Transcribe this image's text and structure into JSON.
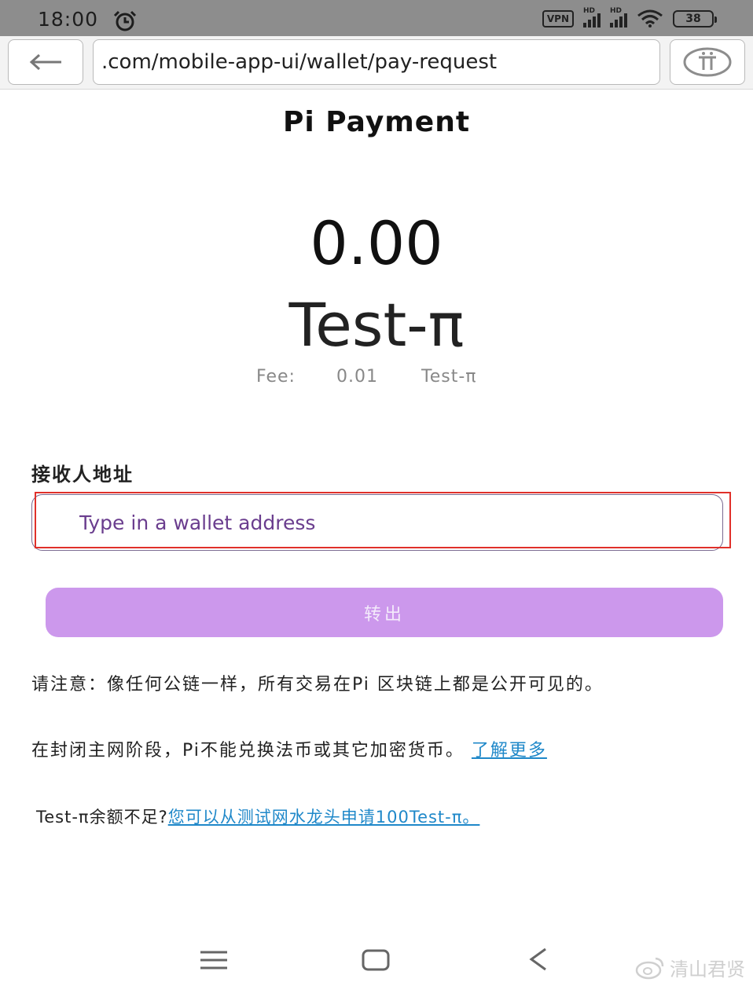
{
  "status_bar": {
    "time": "18:00",
    "vpn_label": "VPN",
    "signal_label_1": "HD",
    "signal_label_2": "HD",
    "battery_level": "38"
  },
  "browser": {
    "url": ".com/mobile-app-ui/wallet/pay-request"
  },
  "page": {
    "title": "Pi Payment",
    "amount": "0.00",
    "currency": "Test-π",
    "fee_label": "Fee:",
    "fee_value": "0.01",
    "fee_currency": "Test-π",
    "recipient_label": "接收人地址",
    "address_placeholder": "Type in a wallet address",
    "transfer_label": "转出",
    "notice_public": "请注意：像任何公链一样，所有交易在Pi 区块链上都是公开可见的。",
    "notice_mainnet": "在封闭主网阶段，Pi不能兑换法币或其它加密货币。",
    "learn_more": "了解更多",
    "insufficient_prefix": "Test-π余额不足?",
    "faucet_link": "您可以从测试网水龙头申请100Test-π。"
  },
  "watermark": "清山君贤",
  "colors": {
    "accent_purple": "#cc98ec",
    "placeholder_purple": "#6a3d8e",
    "link_blue": "#1f88c9",
    "highlight_red": "#e0302a",
    "status_bar_bg": "#8d8d8d"
  },
  "icons": {
    "alarm": "alarm-icon",
    "wifi": "wifi-icon",
    "back": "back-arrow-icon",
    "pi_logo": "pi-logo-icon",
    "nav_menu": "menu-icon",
    "nav_home": "home-icon",
    "nav_back": "back-chevron-icon",
    "weibo": "weibo-icon"
  }
}
